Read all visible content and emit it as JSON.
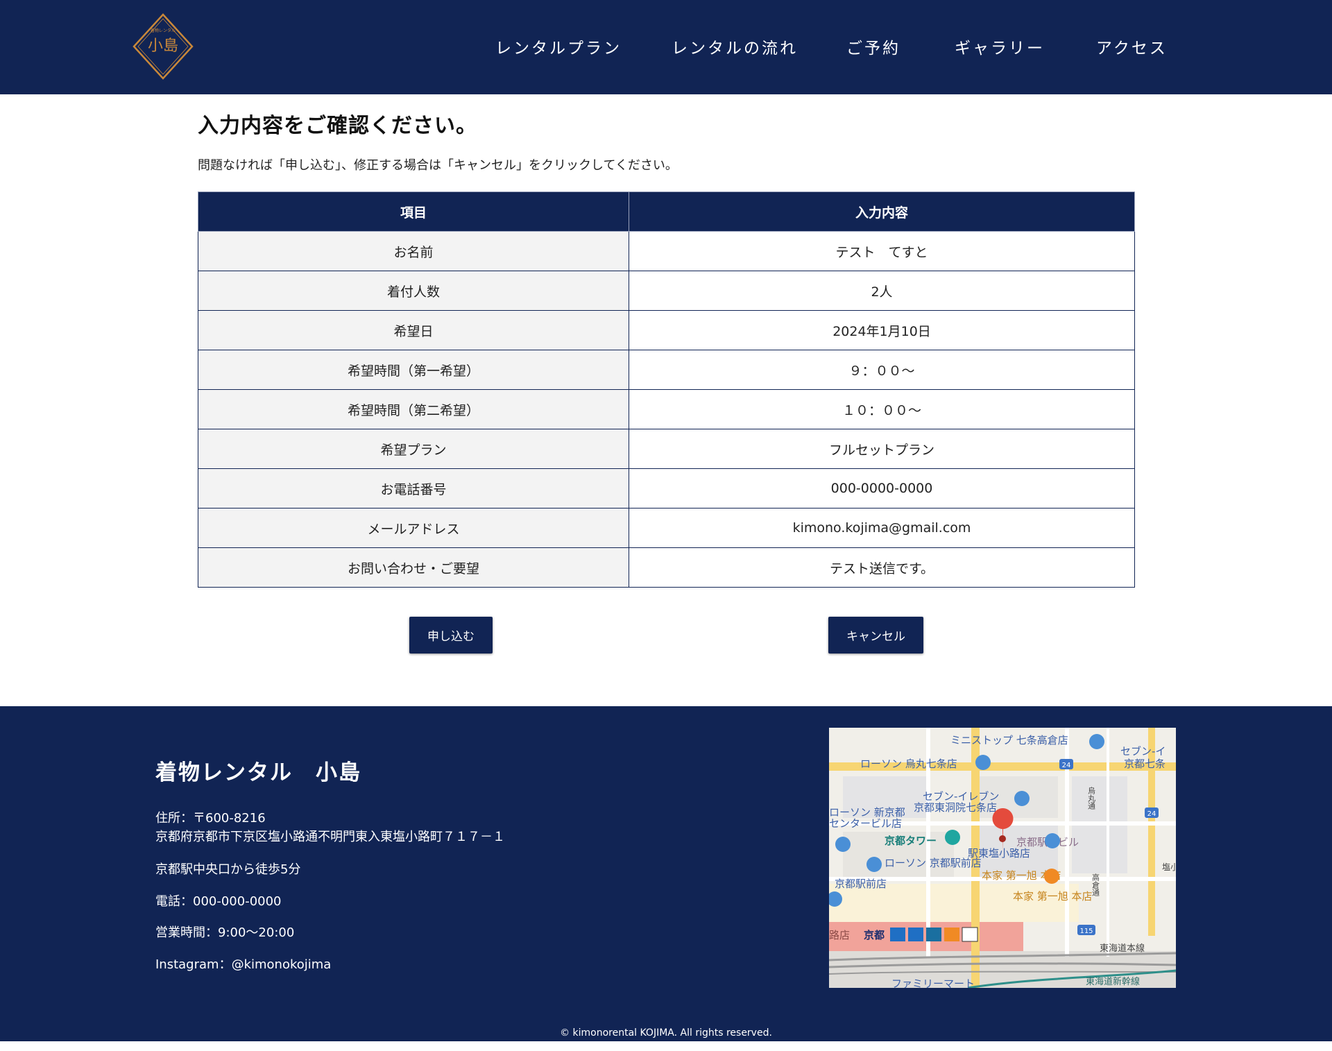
{
  "brand": {
    "logo_text": "小島",
    "logo_small_text": "着物レンタル",
    "colors": {
      "navy": "#112454",
      "gold": "#c9883a"
    }
  },
  "nav": {
    "items": [
      {
        "label": "レンタルプラン"
      },
      {
        "label": "レンタルの流れ"
      },
      {
        "label": "ご予約"
      },
      {
        "label": "ギャラリー"
      },
      {
        "label": "アクセス"
      }
    ]
  },
  "confirm": {
    "title": "入力内容をご確認ください。",
    "lead": "問題なければ「申し込む」、修正する場合は「キャンセル」をクリックしてください。",
    "table": {
      "headers": [
        "項目",
        "入力内容"
      ],
      "rows": [
        {
          "label": "お名前",
          "value": "テスト　てすと"
        },
        {
          "label": "着付人数",
          "value": "2人"
        },
        {
          "label": "希望日",
          "value": "2024年1月10日"
        },
        {
          "label": "希望時間（第一希望）",
          "value": "９：００～"
        },
        {
          "label": "希望時間（第二希望）",
          "value": "１０：００～"
        },
        {
          "label": "希望プラン",
          "value": "フルセットプラン"
        },
        {
          "label": "お電話番号",
          "value": "000-0000-0000"
        },
        {
          "label": "メールアドレス",
          "value": "kimono.kojima@gmail.com"
        },
        {
          "label": "お問い合わせ・ご要望",
          "value": "テスト送信です。"
        }
      ]
    },
    "submit_label": "申し込む",
    "cancel_label": "キャンセル"
  },
  "footer": {
    "shop_name": "着物レンタル　小島",
    "address_line1": "住所：〒600-8216",
    "address_line2": "京都府京都市下京区塩小路通不明門東入東塩小路町７１７－１",
    "directions": "京都駅中央口から徒歩5分",
    "phone": "電話：000-000-0000",
    "hours": "営業時間：9:00～20:00",
    "instagram": "Instagram：@kimonokojima",
    "copyright": "© kimonorental KOJIMA. All rights reserved.",
    "map": {
      "labels": {
        "ministop": "ミニストップ 七条高倉店",
        "seven_top": "セブン-イ",
        "seven_top2": "京都七条",
        "lawson_karasuma": "ローソン 烏丸七条店",
        "seven_higashi1": "セブン-イレブン",
        "seven_higashi2": "京都東洞院七条店",
        "lawson_shin1": "ローソン 新京都",
        "lawson_shin2": "センタービル店",
        "kyoto_tower": "京都タワー",
        "lawson_ekimae": "ローソン 京都駅前店",
        "kyoto_ekimae": "京都駅前店",
        "ekimae_bldg": "京都駅前ビル",
        "higashi_shiokoji": "駅東塩小路店",
        "honke1": "本家 第一旭 本店",
        "honke2": "本家 第一旭 本店",
        "kyoto_station": "京都",
        "tokaido": "東海道本線",
        "shinkansen": "東海道新幹線",
        "family": "ファミリーマート",
        "karasuma_dori": "烏丸通",
        "takakura": "高倉通",
        "shio": "塩小",
        "route24a": "24",
        "route24b": "24",
        "route115": "115",
        "rozan": "路店"
      }
    }
  }
}
